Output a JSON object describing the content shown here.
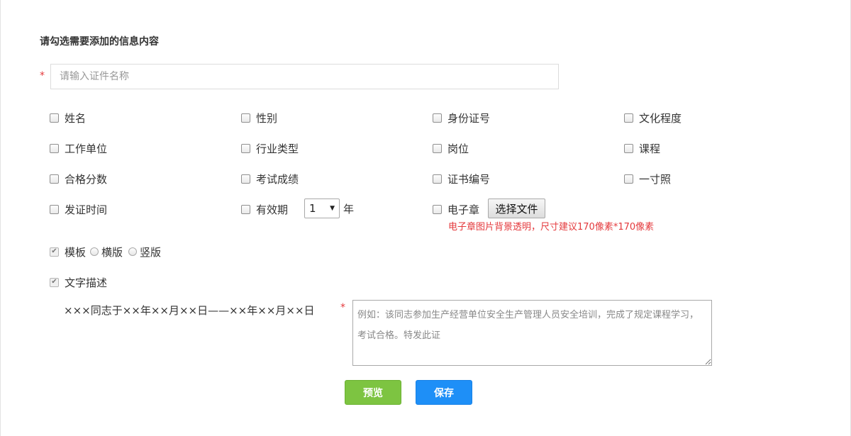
{
  "section_title": "请勾选需要添加的信息内容",
  "required_mark": "*",
  "name_input": {
    "placeholder": "请输入证件名称",
    "value": ""
  },
  "fields": [
    {
      "label": "姓名",
      "checked": false
    },
    {
      "label": "性别",
      "checked": false
    },
    {
      "label": "身份证号",
      "checked": false
    },
    {
      "label": "文化程度",
      "checked": false
    },
    {
      "label": "工作单位",
      "checked": false
    },
    {
      "label": "行业类型",
      "checked": false
    },
    {
      "label": "岗位",
      "checked": false
    },
    {
      "label": "课程",
      "checked": false
    },
    {
      "label": "合格分数",
      "checked": false
    },
    {
      "label": "考试成绩",
      "checked": false
    },
    {
      "label": "证书编号",
      "checked": false
    },
    {
      "label": "一寸照",
      "checked": false
    },
    {
      "label": "发证时间",
      "checked": false
    },
    {
      "label": "有效期",
      "checked": false
    },
    {
      "label": "电子章",
      "checked": false
    }
  ],
  "validity": {
    "selected": "1",
    "unit": "年"
  },
  "seal": {
    "file_button": "选择文件",
    "hint": "电子章图片背景透明，尺寸建议170像素*170像素"
  },
  "template": {
    "label": "模板",
    "checked": true,
    "options": [
      {
        "label": "横版",
        "selected": false
      },
      {
        "label": "竖版",
        "selected": false
      }
    ]
  },
  "text_desc": {
    "label": "文字描述",
    "checked": true,
    "sample": "×××同志于××年××月××日——××年××月××日",
    "placeholder": "例如：该同志参加生产经营单位安全生产管理人员安全培训，完成了规定课程学习，考试合格。特发此证"
  },
  "buttons": {
    "preview": "预览",
    "save": "保存"
  },
  "colors": {
    "required": "#e4393c",
    "preview_bg": "#7dc441",
    "save_bg": "#1e8ff7"
  }
}
